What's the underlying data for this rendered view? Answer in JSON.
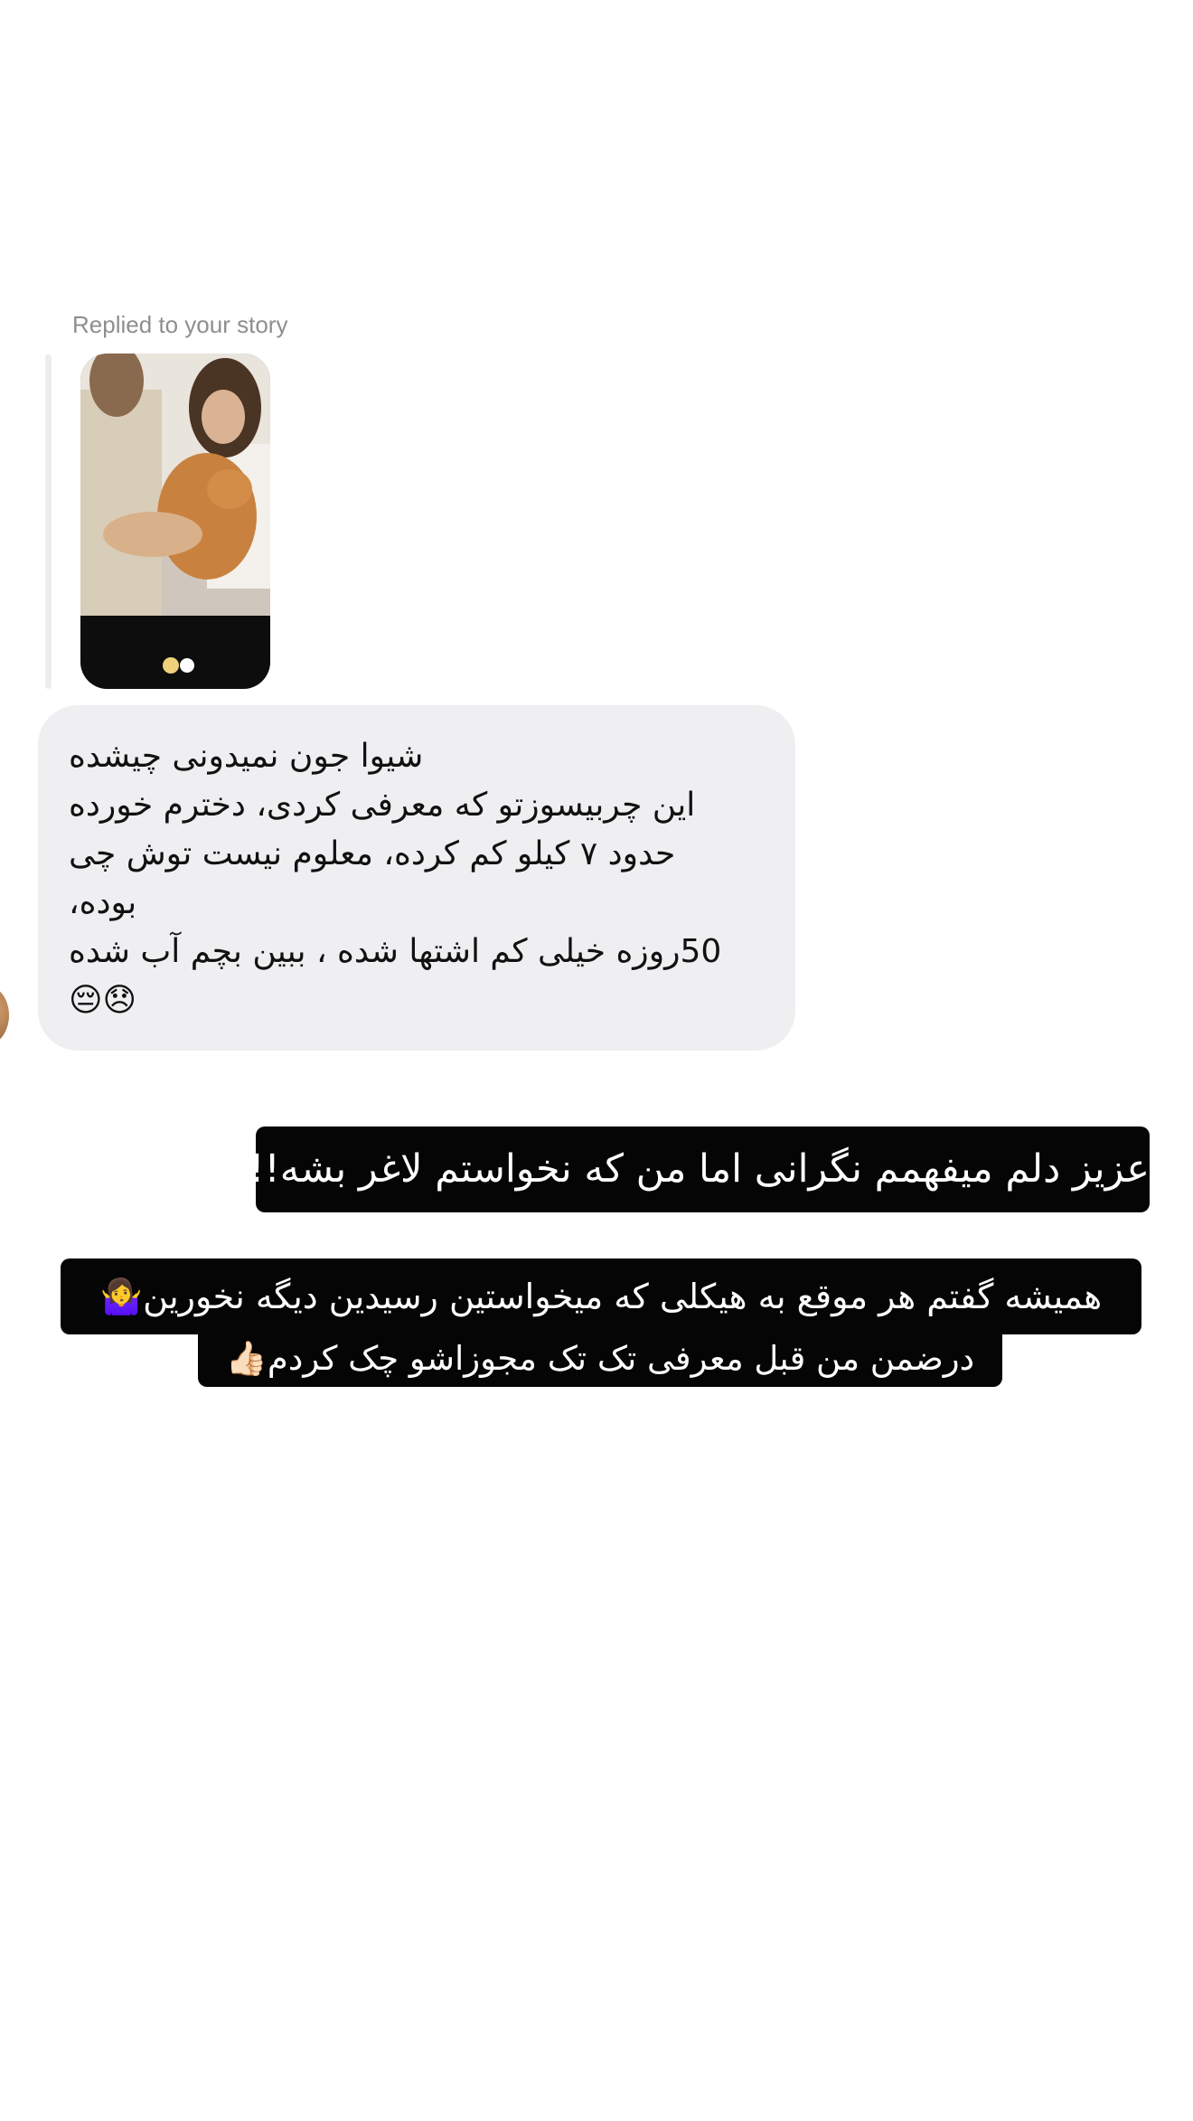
{
  "reply": {
    "label": "Replied to your story"
  },
  "incoming_message": {
    "text": "شیوا جون نمیدونی چیشده\nاین چربیسوزتو که معرفی کردی، دخترم خورده\nحدود ۷ کیلو کم کرده، معلوم نیست توش چی\nبوده،\n50روزه خیلی کم اشتها شده ، ببین بچم آب شده\n😞😔"
  },
  "captions": {
    "line1": "عزیز دلم میفهمم نگرانی اما من که نخواستم لاغر بشه!!",
    "line2": "همیشه گفتم هر موقع به هیکلی که میخواستین رسیدین دیگه نخورین🤷‍♀️",
    "line3": "درضمن من قبل معرفی تک تک مجوزاشو چک کردم👍🏻"
  }
}
